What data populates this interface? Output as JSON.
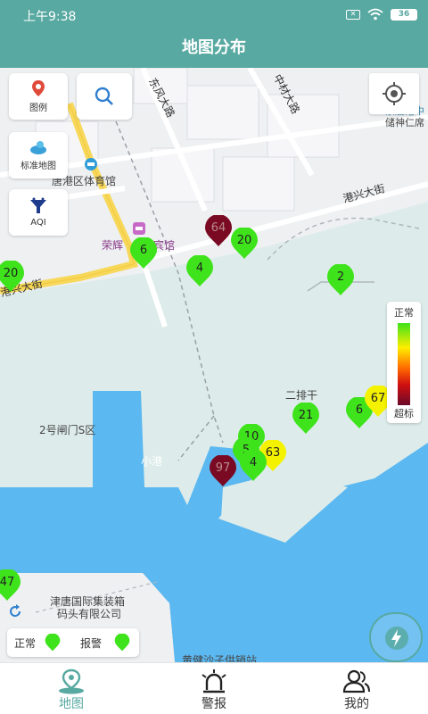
{
  "status_bar": {
    "time": "上午9:38",
    "battery": "36"
  },
  "header": {
    "title": "地图分布"
  },
  "controls": {
    "legend_label": "图例",
    "standard_map_label": "标准地图",
    "aqi_label": "AQI"
  },
  "map_labels": {
    "roads": [
      "东风大路",
      "中材大路",
      "港兴大街",
      "港兴大街"
    ],
    "places": [
      "唐港区体育馆",
      "荣辉",
      "宾馆",
      "京唐港中",
      "储神仁席",
      "二排干",
      "2号闸门S区",
      "小港",
      "津唐国际集装箱",
      "码头有限公司",
      "黄健沙子供销站"
    ]
  },
  "markers": [
    {
      "value": "20",
      "status": "normal"
    },
    {
      "value": "6",
      "status": "normal"
    },
    {
      "value": "64",
      "status": "alarm"
    },
    {
      "value": "20",
      "status": "normal"
    },
    {
      "value": "4",
      "status": "normal"
    },
    {
      "value": "2",
      "status": "normal"
    },
    {
      "value": "21",
      "status": "normal"
    },
    {
      "value": "6",
      "status": "normal"
    },
    {
      "value": "67",
      "status": "warning"
    },
    {
      "value": "10",
      "status": "normal"
    },
    {
      "value": "5",
      "status": "normal"
    },
    {
      "value": "63",
      "status": "warning"
    },
    {
      "value": "4",
      "status": "normal"
    },
    {
      "value": "97",
      "status": "alarm"
    },
    {
      "value": "47",
      "status": "normal"
    }
  ],
  "color_legend": {
    "top_label": "正常",
    "bottom_label": "超标"
  },
  "bottom_legend": {
    "normal_label": "正常",
    "alarm_label": "报警"
  },
  "tabs": [
    {
      "label": "地图",
      "icon": "map-pin-icon",
      "active": true
    },
    {
      "label": "警报",
      "icon": "alarm-siren-icon",
      "active": false
    },
    {
      "label": "我的",
      "icon": "users-icon",
      "active": false
    }
  ],
  "colors": {
    "accent": "#58a9a1",
    "normal": "#3ee31b",
    "warning": "#f5f200",
    "alarm": "#7a0a24",
    "water": "#5bb8f0"
  }
}
